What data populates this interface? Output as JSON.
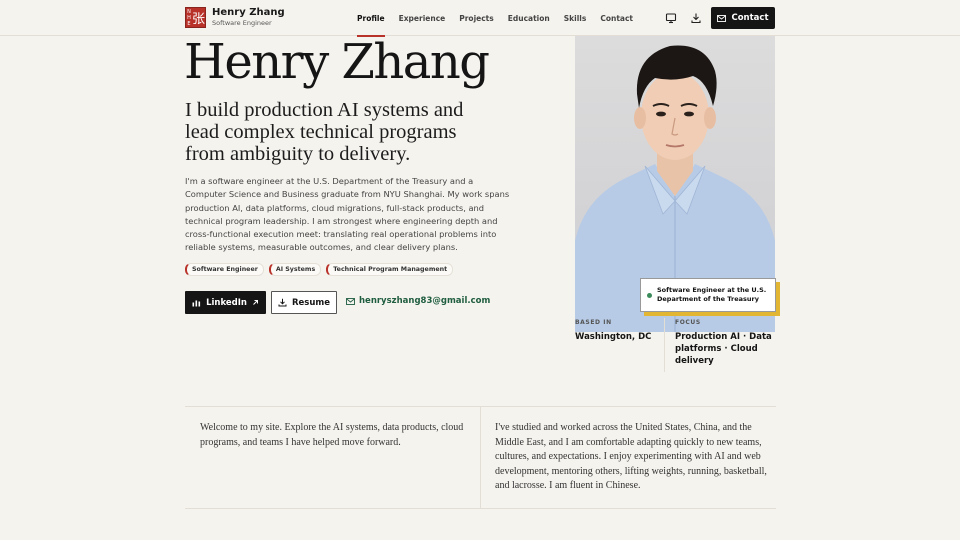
{
  "header": {
    "logo_glyphs": {
      "left_top": "N",
      "left_mid": "H",
      "left_bot": "E",
      "big": "张"
    },
    "name": "Henry Zhang",
    "role": "Software Engineer",
    "nav": [
      "Profile",
      "Experience",
      "Projects",
      "Education",
      "Skills",
      "Contact"
    ],
    "active_nav": "Profile",
    "icons": [
      "monitor-icon",
      "download-icon"
    ],
    "contact_label": "Contact"
  },
  "hero": {
    "name": "Henry Zhang",
    "tagline": "I build production AI systems and lead complex technical programs from ambiguity to delivery.",
    "intro": "I'm a software engineer at the U.S. Department of the Treasury and a Computer Science and Business graduate from NYU Shanghai. My work spans production AI, data platforms, cloud migrations, full-stack products, and technical program leadership. I am strongest where engineering depth and cross-functional execution meet: translating real operational problems into reliable systems, measurable outcomes, and clear delivery plans.",
    "tags": [
      "Software Engineer",
      "AI Systems",
      "Technical Program Management"
    ],
    "linkedin_label": "LinkedIn",
    "resume_label": "Resume",
    "email": "henryszhang83@gmail.com"
  },
  "profile_card": {
    "caption": "Software Engineer at the U.S. Department of the Treasury",
    "based_in_label": "BASED IN",
    "based_in_value": "Washington, DC",
    "focus_label": "FOCUS",
    "focus_value": "Production AI · Data platforms · Cloud delivery"
  },
  "lower": {
    "welcome": "Welcome to my site. Explore the AI systems, data products, cloud programs, and teams I have helped move forward.",
    "about": "I've studied and worked across the United States, China, and the Middle East, and I am comfortable adapting quickly to new teams, cultures, and expectations. I enjoy experimenting with AI and web development, mentoring others, lifting weights, running, basketball, and lacrosse. I am fluent in Chinese."
  },
  "colors": {
    "accent": "#b8322a",
    "dark": "#151515",
    "link": "#1f5d3f",
    "highlight": "#e2b632",
    "background": "#f5f3ee"
  }
}
